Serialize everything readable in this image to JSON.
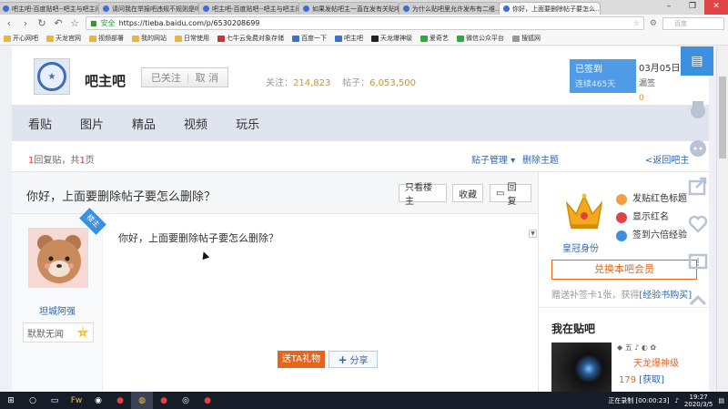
{
  "browser": {
    "tabs": [
      {
        "label": "吧主吧-百度贴吧--吧主与吧主间..."
      },
      {
        "label": "请问我在举报吧违规不规则是吗..."
      },
      {
        "label": "吧主吧-百度贴吧--吧主与吧主间..."
      },
      {
        "label": "如果发帖吧主一直在发有关贴吧..."
      },
      {
        "label": "为什么贴吧里允许发布有二维..."
      },
      {
        "label": "你好，上面要删除帖子要怎么..."
      }
    ],
    "window_controls": {
      "minimize": "–",
      "restore": "❐",
      "close": "✕"
    },
    "secure_label": "安全",
    "url": "https://tieba.baidu.com/p/6530208699",
    "search_placeholder": "百度",
    "bookmarks": [
      "开心网吧",
      "天龙官网",
      "视频部署",
      "我的网站",
      "日常使用",
      "七牛云免费对象存储",
      "百度一下",
      "吧主吧",
      "天龙爆神级",
      "爱奇艺",
      "微信公众平台",
      "搜狐网"
    ]
  },
  "forum": {
    "name": "吧主吧",
    "follow_label": "已关注",
    "unfollow_label": "取 消",
    "followers_label": "关注：",
    "followers": "214,823",
    "posts_label": "帖子：",
    "posts": "6,053,500",
    "signed_label": "已签到",
    "streak": "连续465天",
    "date": "03月05日",
    "missed_label": "漏签",
    "missed": "0",
    "missed_unit": "天"
  },
  "nav": [
    "看贴",
    "图片",
    "精品",
    "视频",
    "玩乐"
  ],
  "pager": {
    "reply_count": "1",
    "reply_text": "回复贴，共",
    "page_count": "1",
    "page_unit": "页",
    "manage_label": "贴子管理 ▾",
    "delete_label": "删除主题",
    "back_label": "<返回吧主"
  },
  "thread": {
    "title": "你好，上面要删除帖子要怎么删除？",
    "only_op_label": "只看楼主",
    "favorite_label": "收藏",
    "reply_label": "回复"
  },
  "post": {
    "op_badge": "楼主",
    "author": "坦城阿强",
    "badge_text": "默默无闻",
    "level": "1",
    "content": "你好，上面要删除帖子要怎么删除？",
    "gift_label": "送TA礼物",
    "share_label": "分享"
  },
  "sidebar": {
    "crown_label": "皇冠身份",
    "privileges": [
      "发贴红色标题",
      "显示红名",
      "签到六倍经验"
    ],
    "redeem_label": "兑换本吧会员",
    "gift_line": "赠送补签卡1张，获得",
    "gift_link": "[经验书购买]",
    "in_forum_title": "我在贴吧",
    "user_icons": "◆ 五 ♪ ◐ ✿",
    "user_name": "天龙爆神级",
    "user_tbean": "179",
    "user_get": "[获取]"
  },
  "taskbar": {
    "recording": "正在录制 [00:00:23]",
    "time": "19:27",
    "date": "2020/3/5"
  },
  "colors": {
    "accent_blue": "#3d8fe0",
    "link_blue": "#2d64b3",
    "orange": "#e8641b",
    "stat_orange": "#e08e0b"
  }
}
